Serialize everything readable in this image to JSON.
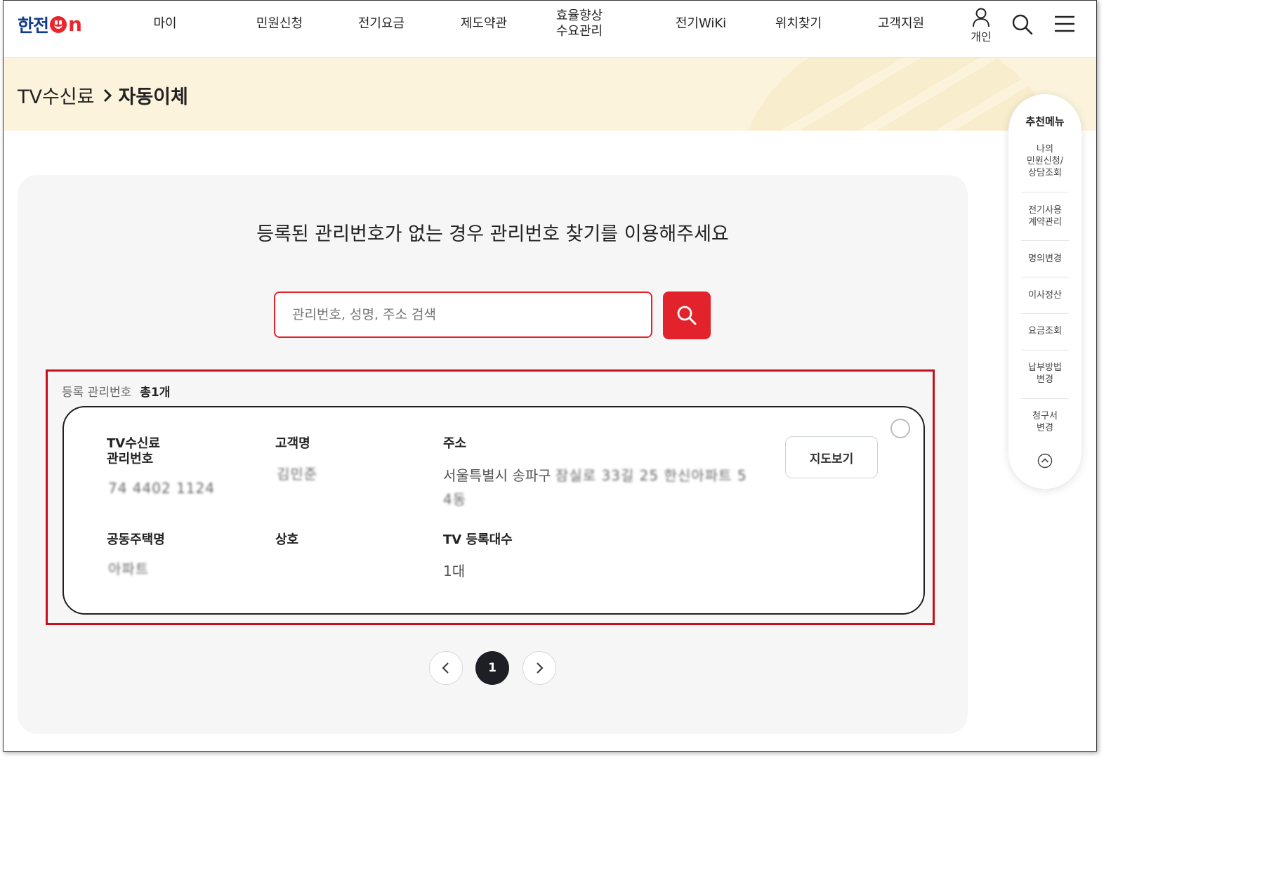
{
  "header": {
    "logo_han": "한전",
    "logo_on": "n",
    "nav": [
      {
        "label": "마이"
      },
      {
        "label": "민원신청"
      },
      {
        "label": "전기요금"
      },
      {
        "label": "제도약관"
      },
      {
        "label": "효율향상\n수요관리"
      },
      {
        "label": "전기WiKi"
      },
      {
        "label": "위치찾기"
      },
      {
        "label": "고객지원"
      }
    ],
    "user_label": "개인"
  },
  "breadcrumb": {
    "parent": "TV수신료",
    "current": "자동이체"
  },
  "main": {
    "headline": "등록된 관리번호가 없는 경우 관리번호 찾기를 이용해주세요",
    "search": {
      "placeholder": "관리번호, 성명, 주소 검색",
      "value": ""
    },
    "result_label": "등록 관리번호",
    "result_total": "총1개",
    "card": {
      "tv_label": "TV수신료\n관리번호",
      "tv_value": "74 4402 1124",
      "name_label": "고객명",
      "name_value": "김민준",
      "address_label": "주소",
      "address_value": "서울특별시 송파구",
      "address_value_blur": "잠실로 33길 25 한신아파트 5",
      "address_value_blur2": "4동",
      "map_button": "지도보기",
      "apt_label": "공동주택명",
      "apt_value": "아파트",
      "company_label": "상호",
      "company_value": "",
      "tv_count_label": "TV 등록대수",
      "tv_count_value": "1대"
    },
    "pagination": {
      "current": "1"
    }
  },
  "quick_menu": {
    "title": "추천메뉴",
    "items": [
      {
        "label": "나의\n민원신청/\n상담조회"
      },
      {
        "label": "전기사용\n계약관리"
      },
      {
        "label": "명의변경"
      },
      {
        "label": "이사정산"
      },
      {
        "label": "요금조회"
      },
      {
        "label": "납부방법\n변경"
      },
      {
        "label": "청구서\n변경"
      }
    ]
  },
  "colors": {
    "brand_red": "#e3232c",
    "brand_navy": "#123c8c",
    "banner_bg": "#fbf3dc",
    "highlight_border": "#c4101a"
  }
}
